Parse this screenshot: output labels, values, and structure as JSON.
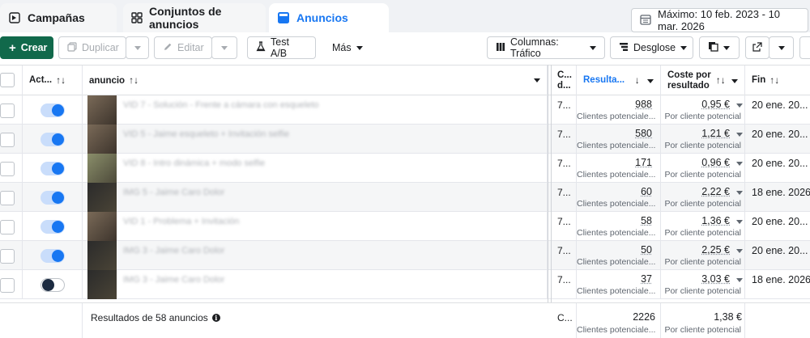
{
  "tabs": [
    {
      "label": "Campañas",
      "icon": "flag-icon"
    },
    {
      "label": "Conjuntos de anuncios",
      "icon": "grid-icon"
    },
    {
      "label": "Anuncios",
      "icon": "ad-card-icon"
    }
  ],
  "date_range": "Máximo: 10 feb. 2023 - 10 mar. 2026",
  "toolbar": {
    "create": "Crear",
    "duplicate": "Duplicar",
    "edit": "Editar",
    "ab_test": "Test A/B",
    "more": "Más",
    "columns": "Columnas: Tráfico",
    "breakdown": "Desglose"
  },
  "headers": {
    "active": "Act...",
    "ad": "anuncio",
    "delivery_line1": "C...",
    "delivery_line2": "d...",
    "results": "Resulta...",
    "cost_line1": "Coste por",
    "cost_line2": "resultado",
    "end": "Fin"
  },
  "rows": [
    {
      "active": true,
      "name": "VID 7 - Solución - Frente a cámara con esqueleto",
      "delivery": "7...",
      "results": "988",
      "results_sub": "Clientes potenciale...",
      "cost": "0,95 €",
      "cost_sub": "Por cliente potencial",
      "end": "20 ene. 20..."
    },
    {
      "active": true,
      "name": "VID 5 - Jaime esqueleto + Invitación selfie",
      "delivery": "7...",
      "results": "580",
      "results_sub": "Clientes potenciale...",
      "cost": "1,21 €",
      "cost_sub": "Por cliente potencial",
      "end": "20 ene. 20..."
    },
    {
      "active": true,
      "name": "VID 8 - Intro dinámica + modo selfie",
      "delivery": "7...",
      "results": "171",
      "results_sub": "Clientes potenciale...",
      "cost": "0,96 €",
      "cost_sub": "Por cliente potencial",
      "end": "20 ene. 20..."
    },
    {
      "active": true,
      "name": "IMG 5 - Jaime Caro Dolor",
      "delivery": "7...",
      "results": "60",
      "results_sub": "Clientes potenciale...",
      "cost": "2,22 €",
      "cost_sub": "Por cliente potencial",
      "end": "18 ene. 2026"
    },
    {
      "active": true,
      "name": "VID 1 - Problema + Invitación",
      "delivery": "7...",
      "results": "58",
      "results_sub": "Clientes potenciale...",
      "cost": "1,36 €",
      "cost_sub": "Por cliente potencial",
      "end": "20 ene. 20..."
    },
    {
      "active": true,
      "name": "IMG 3 - Jaime Caro Dolor",
      "delivery": "7...",
      "results": "50",
      "results_sub": "Clientes potenciale...",
      "cost": "2,25 €",
      "cost_sub": "Por cliente potencial",
      "end": "20 ene. 20..."
    },
    {
      "active": false,
      "name": "IMG 3 - Jaime Caro Dolor",
      "delivery": "7...",
      "results": "37",
      "results_sub": "Clientes potenciale...",
      "cost": "3,03 €",
      "cost_sub": "Por cliente potencial",
      "end": "18 ene. 2026"
    }
  ],
  "footer": {
    "label": "Resultados de 58 anuncios",
    "delivery": "C...",
    "results": "2226",
    "results_sub": "Clientes potenciale...",
    "cost": "1,38 €",
    "cost_sub": "Por cliente potencial"
  }
}
